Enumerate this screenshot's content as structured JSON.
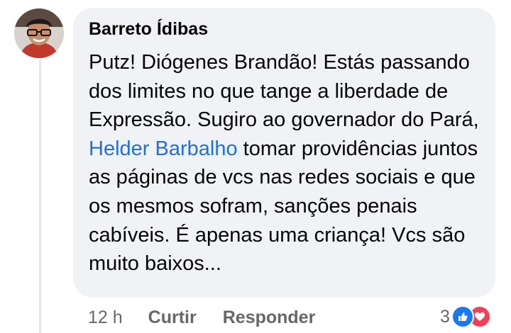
{
  "comment": {
    "author": "Barreto Ídibas",
    "text_part1": "Putz! Diógenes Brandão! Estás passando dos limites no que tange a liberdade de Expressão. Sugiro ao governador do Pará, ",
    "mention": "Helder Barbalho",
    "text_part2": " tomar providências juntos as páginas de vcs nas redes sociais e que os mesmos sofram, sanções penais cabíveis. É apenas uma criança! Vcs são muito baixos...",
    "time": "12 h",
    "like_label": "Curtir",
    "reply_label": "Responder",
    "reaction_count": "3",
    "reactions": [
      "like-icon",
      "love-icon"
    ]
  },
  "colors": {
    "bubble": "#f0f2f5",
    "mention": "#216fdb",
    "meta": "#65676b",
    "like": "#1877f2",
    "love": "#f33e58"
  }
}
